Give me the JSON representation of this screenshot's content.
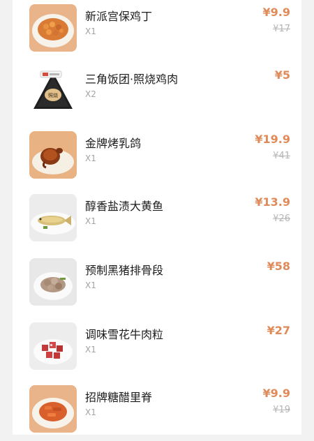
{
  "items": [
    {
      "name": "新派宫保鸡丁",
      "qty": "X1",
      "price": "¥9.9",
      "original_price": "¥17",
      "image": "kung-pao-chicken"
    },
    {
      "name": "三角饭团·照烧鸡肉",
      "qty": "X2",
      "price": "¥5",
      "original_price": "",
      "image": "rice-ball",
      "package_text": "照烧"
    },
    {
      "name": "金牌烤乳鸽",
      "qty": "X1",
      "price": "¥19.9",
      "original_price": "¥41",
      "image": "roast-pigeon"
    },
    {
      "name": "醇香盐渍大黄鱼",
      "qty": "X1",
      "price": "¥13.9",
      "original_price": "¥26",
      "image": "yellow-croaker"
    },
    {
      "name": "预制黑猪排骨段",
      "qty": "X1",
      "price": "¥58",
      "original_price": "",
      "image": "pork-ribs"
    },
    {
      "name": "调味雪花牛肉粒",
      "qty": "X1",
      "price": "¥27",
      "original_price": "",
      "image": "beef-cubes"
    },
    {
      "name": "招牌糖醋里脊",
      "qty": "X1",
      "price": "¥9.9",
      "original_price": "¥19",
      "image": "sweet-sour-pork"
    }
  ],
  "colors": {
    "price": "#e18a59",
    "strike": "#b5b5b5",
    "name": "#1c1c1c",
    "qty": "#a3a3a3"
  }
}
